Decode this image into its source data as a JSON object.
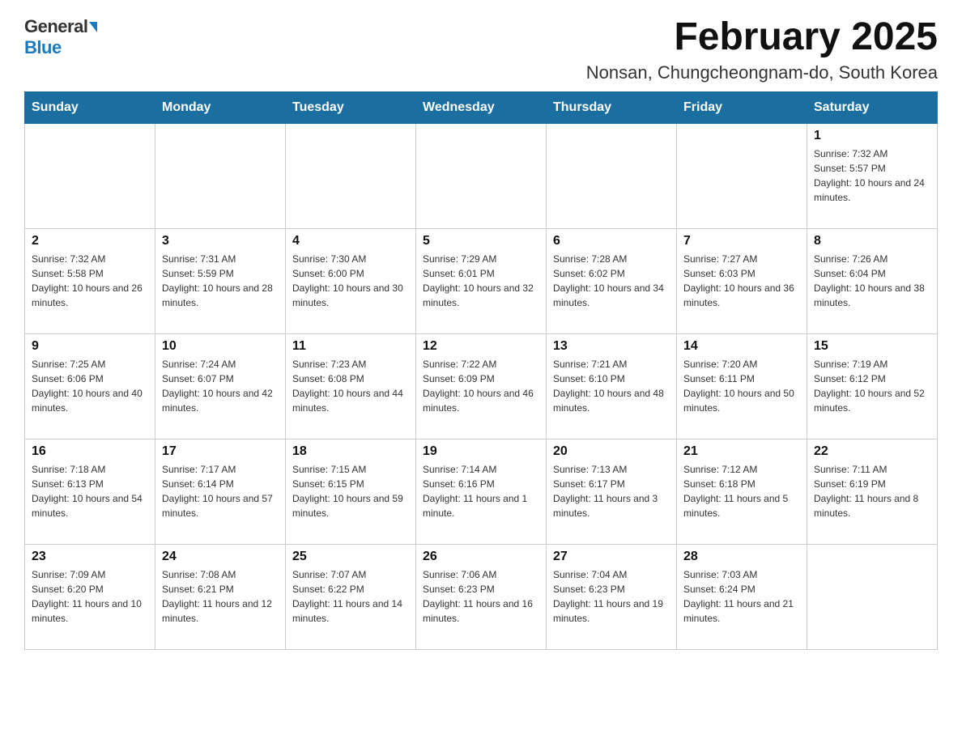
{
  "header": {
    "logo": {
      "general": "General",
      "blue": "Blue"
    },
    "title": "February 2025",
    "location": "Nonsan, Chungcheongnam-do, South Korea"
  },
  "weekdays": [
    "Sunday",
    "Monday",
    "Tuesday",
    "Wednesday",
    "Thursday",
    "Friday",
    "Saturday"
  ],
  "weeks": [
    [
      {
        "day": "",
        "info": ""
      },
      {
        "day": "",
        "info": ""
      },
      {
        "day": "",
        "info": ""
      },
      {
        "day": "",
        "info": ""
      },
      {
        "day": "",
        "info": ""
      },
      {
        "day": "",
        "info": ""
      },
      {
        "day": "1",
        "info": "Sunrise: 7:32 AM\nSunset: 5:57 PM\nDaylight: 10 hours and 24 minutes."
      }
    ],
    [
      {
        "day": "2",
        "info": "Sunrise: 7:32 AM\nSunset: 5:58 PM\nDaylight: 10 hours and 26 minutes."
      },
      {
        "day": "3",
        "info": "Sunrise: 7:31 AM\nSunset: 5:59 PM\nDaylight: 10 hours and 28 minutes."
      },
      {
        "day": "4",
        "info": "Sunrise: 7:30 AM\nSunset: 6:00 PM\nDaylight: 10 hours and 30 minutes."
      },
      {
        "day": "5",
        "info": "Sunrise: 7:29 AM\nSunset: 6:01 PM\nDaylight: 10 hours and 32 minutes."
      },
      {
        "day": "6",
        "info": "Sunrise: 7:28 AM\nSunset: 6:02 PM\nDaylight: 10 hours and 34 minutes."
      },
      {
        "day": "7",
        "info": "Sunrise: 7:27 AM\nSunset: 6:03 PM\nDaylight: 10 hours and 36 minutes."
      },
      {
        "day": "8",
        "info": "Sunrise: 7:26 AM\nSunset: 6:04 PM\nDaylight: 10 hours and 38 minutes."
      }
    ],
    [
      {
        "day": "9",
        "info": "Sunrise: 7:25 AM\nSunset: 6:06 PM\nDaylight: 10 hours and 40 minutes."
      },
      {
        "day": "10",
        "info": "Sunrise: 7:24 AM\nSunset: 6:07 PM\nDaylight: 10 hours and 42 minutes."
      },
      {
        "day": "11",
        "info": "Sunrise: 7:23 AM\nSunset: 6:08 PM\nDaylight: 10 hours and 44 minutes."
      },
      {
        "day": "12",
        "info": "Sunrise: 7:22 AM\nSunset: 6:09 PM\nDaylight: 10 hours and 46 minutes."
      },
      {
        "day": "13",
        "info": "Sunrise: 7:21 AM\nSunset: 6:10 PM\nDaylight: 10 hours and 48 minutes."
      },
      {
        "day": "14",
        "info": "Sunrise: 7:20 AM\nSunset: 6:11 PM\nDaylight: 10 hours and 50 minutes."
      },
      {
        "day": "15",
        "info": "Sunrise: 7:19 AM\nSunset: 6:12 PM\nDaylight: 10 hours and 52 minutes."
      }
    ],
    [
      {
        "day": "16",
        "info": "Sunrise: 7:18 AM\nSunset: 6:13 PM\nDaylight: 10 hours and 54 minutes."
      },
      {
        "day": "17",
        "info": "Sunrise: 7:17 AM\nSunset: 6:14 PM\nDaylight: 10 hours and 57 minutes."
      },
      {
        "day": "18",
        "info": "Sunrise: 7:15 AM\nSunset: 6:15 PM\nDaylight: 10 hours and 59 minutes."
      },
      {
        "day": "19",
        "info": "Sunrise: 7:14 AM\nSunset: 6:16 PM\nDaylight: 11 hours and 1 minute."
      },
      {
        "day": "20",
        "info": "Sunrise: 7:13 AM\nSunset: 6:17 PM\nDaylight: 11 hours and 3 minutes."
      },
      {
        "day": "21",
        "info": "Sunrise: 7:12 AM\nSunset: 6:18 PM\nDaylight: 11 hours and 5 minutes."
      },
      {
        "day": "22",
        "info": "Sunrise: 7:11 AM\nSunset: 6:19 PM\nDaylight: 11 hours and 8 minutes."
      }
    ],
    [
      {
        "day": "23",
        "info": "Sunrise: 7:09 AM\nSunset: 6:20 PM\nDaylight: 11 hours and 10 minutes."
      },
      {
        "day": "24",
        "info": "Sunrise: 7:08 AM\nSunset: 6:21 PM\nDaylight: 11 hours and 12 minutes."
      },
      {
        "day": "25",
        "info": "Sunrise: 7:07 AM\nSunset: 6:22 PM\nDaylight: 11 hours and 14 minutes."
      },
      {
        "day": "26",
        "info": "Sunrise: 7:06 AM\nSunset: 6:23 PM\nDaylight: 11 hours and 16 minutes."
      },
      {
        "day": "27",
        "info": "Sunrise: 7:04 AM\nSunset: 6:23 PM\nDaylight: 11 hours and 19 minutes."
      },
      {
        "day": "28",
        "info": "Sunrise: 7:03 AM\nSunset: 6:24 PM\nDaylight: 11 hours and 21 minutes."
      },
      {
        "day": "",
        "info": ""
      }
    ]
  ]
}
